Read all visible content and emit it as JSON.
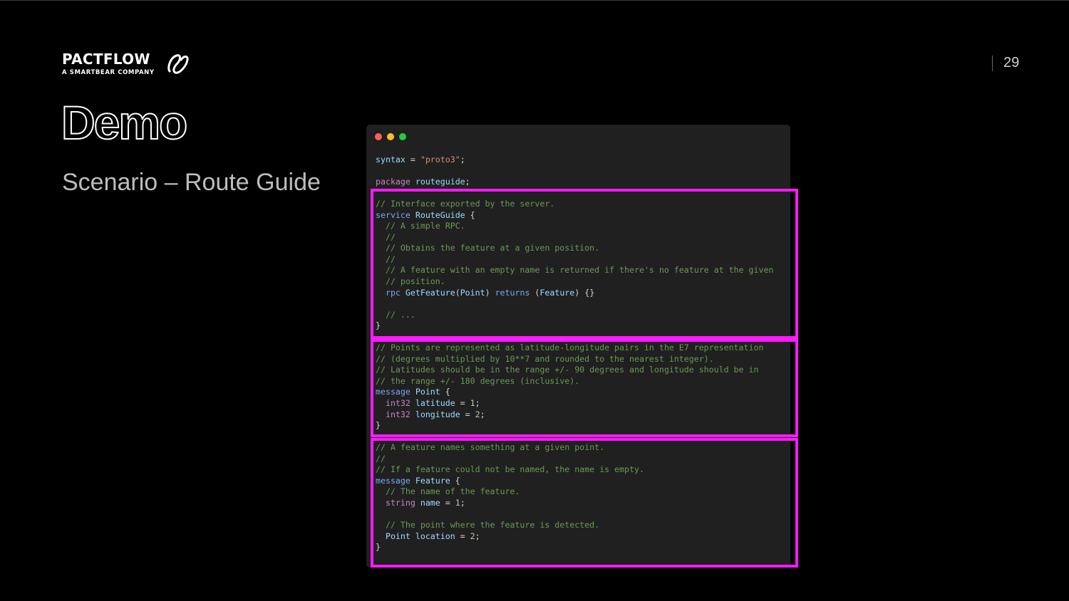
{
  "brand": {
    "name": "PACTFLOW",
    "tagline": "A SMARTBEAR COMPANY"
  },
  "slide": {
    "page_number": "29",
    "title": "Demo",
    "subtitle": "Scenario – Route Guide"
  },
  "editor": {
    "window_controls": [
      "close",
      "minimize",
      "maximize"
    ],
    "code": {
      "l01": [
        "syntax",
        " = ",
        "\"proto3\"",
        ";"
      ],
      "l02": "",
      "l03": [
        "package",
        " routeguide",
        ";"
      ],
      "l04": "",
      "l05": "// Interface exported by the server.",
      "l06": [
        "service",
        " RouteGuide",
        " {"
      ],
      "l07": "  // A simple RPC.",
      "l08": "  //",
      "l09": "  // Obtains the feature at a given position.",
      "l10": "  //",
      "l11": "  // A feature with an empty name is returned if there's no feature at the given",
      "l12": "  // position.",
      "l13": [
        "  ",
        "rpc",
        " GetFeature",
        "(",
        "Point",
        ") ",
        "returns",
        " (",
        "Feature",
        ") {}"
      ],
      "l14": "",
      "l15": "  // ...",
      "l16": "}",
      "l17": "",
      "l18": "// Points are represented as latitude-longitude pairs in the E7 representation",
      "l19": "// (degrees multiplied by 10**7 and rounded to the nearest integer).",
      "l20": "// Latitudes should be in the range +/- 90 degrees and longitude should be in",
      "l21": "// the range +/- 180 degrees (inclusive).",
      "l22": [
        "message",
        " Point",
        " {"
      ],
      "l23": [
        "  ",
        "int32",
        " latitude",
        " = ",
        "1",
        ";"
      ],
      "l24": [
        "  ",
        "int32",
        " longitude",
        " = ",
        "2",
        ";"
      ],
      "l25": "}",
      "l26": "",
      "l27": "// A feature names something at a given point.",
      "l28": "//",
      "l29": "// If a feature could not be named, the name is empty.",
      "l30": [
        "message",
        " Feature",
        " {"
      ],
      "l31": "  // The name of the feature.",
      "l32": [
        "  ",
        "string",
        " name",
        " = ",
        "1",
        ";"
      ],
      "l33": "",
      "l34": "  // The point where the feature is detected.",
      "l35": [
        "  ",
        "Point",
        " location",
        " = ",
        "2",
        ";"
      ],
      "l36": "}"
    }
  },
  "highlight": {
    "color": "#ff19ff"
  }
}
